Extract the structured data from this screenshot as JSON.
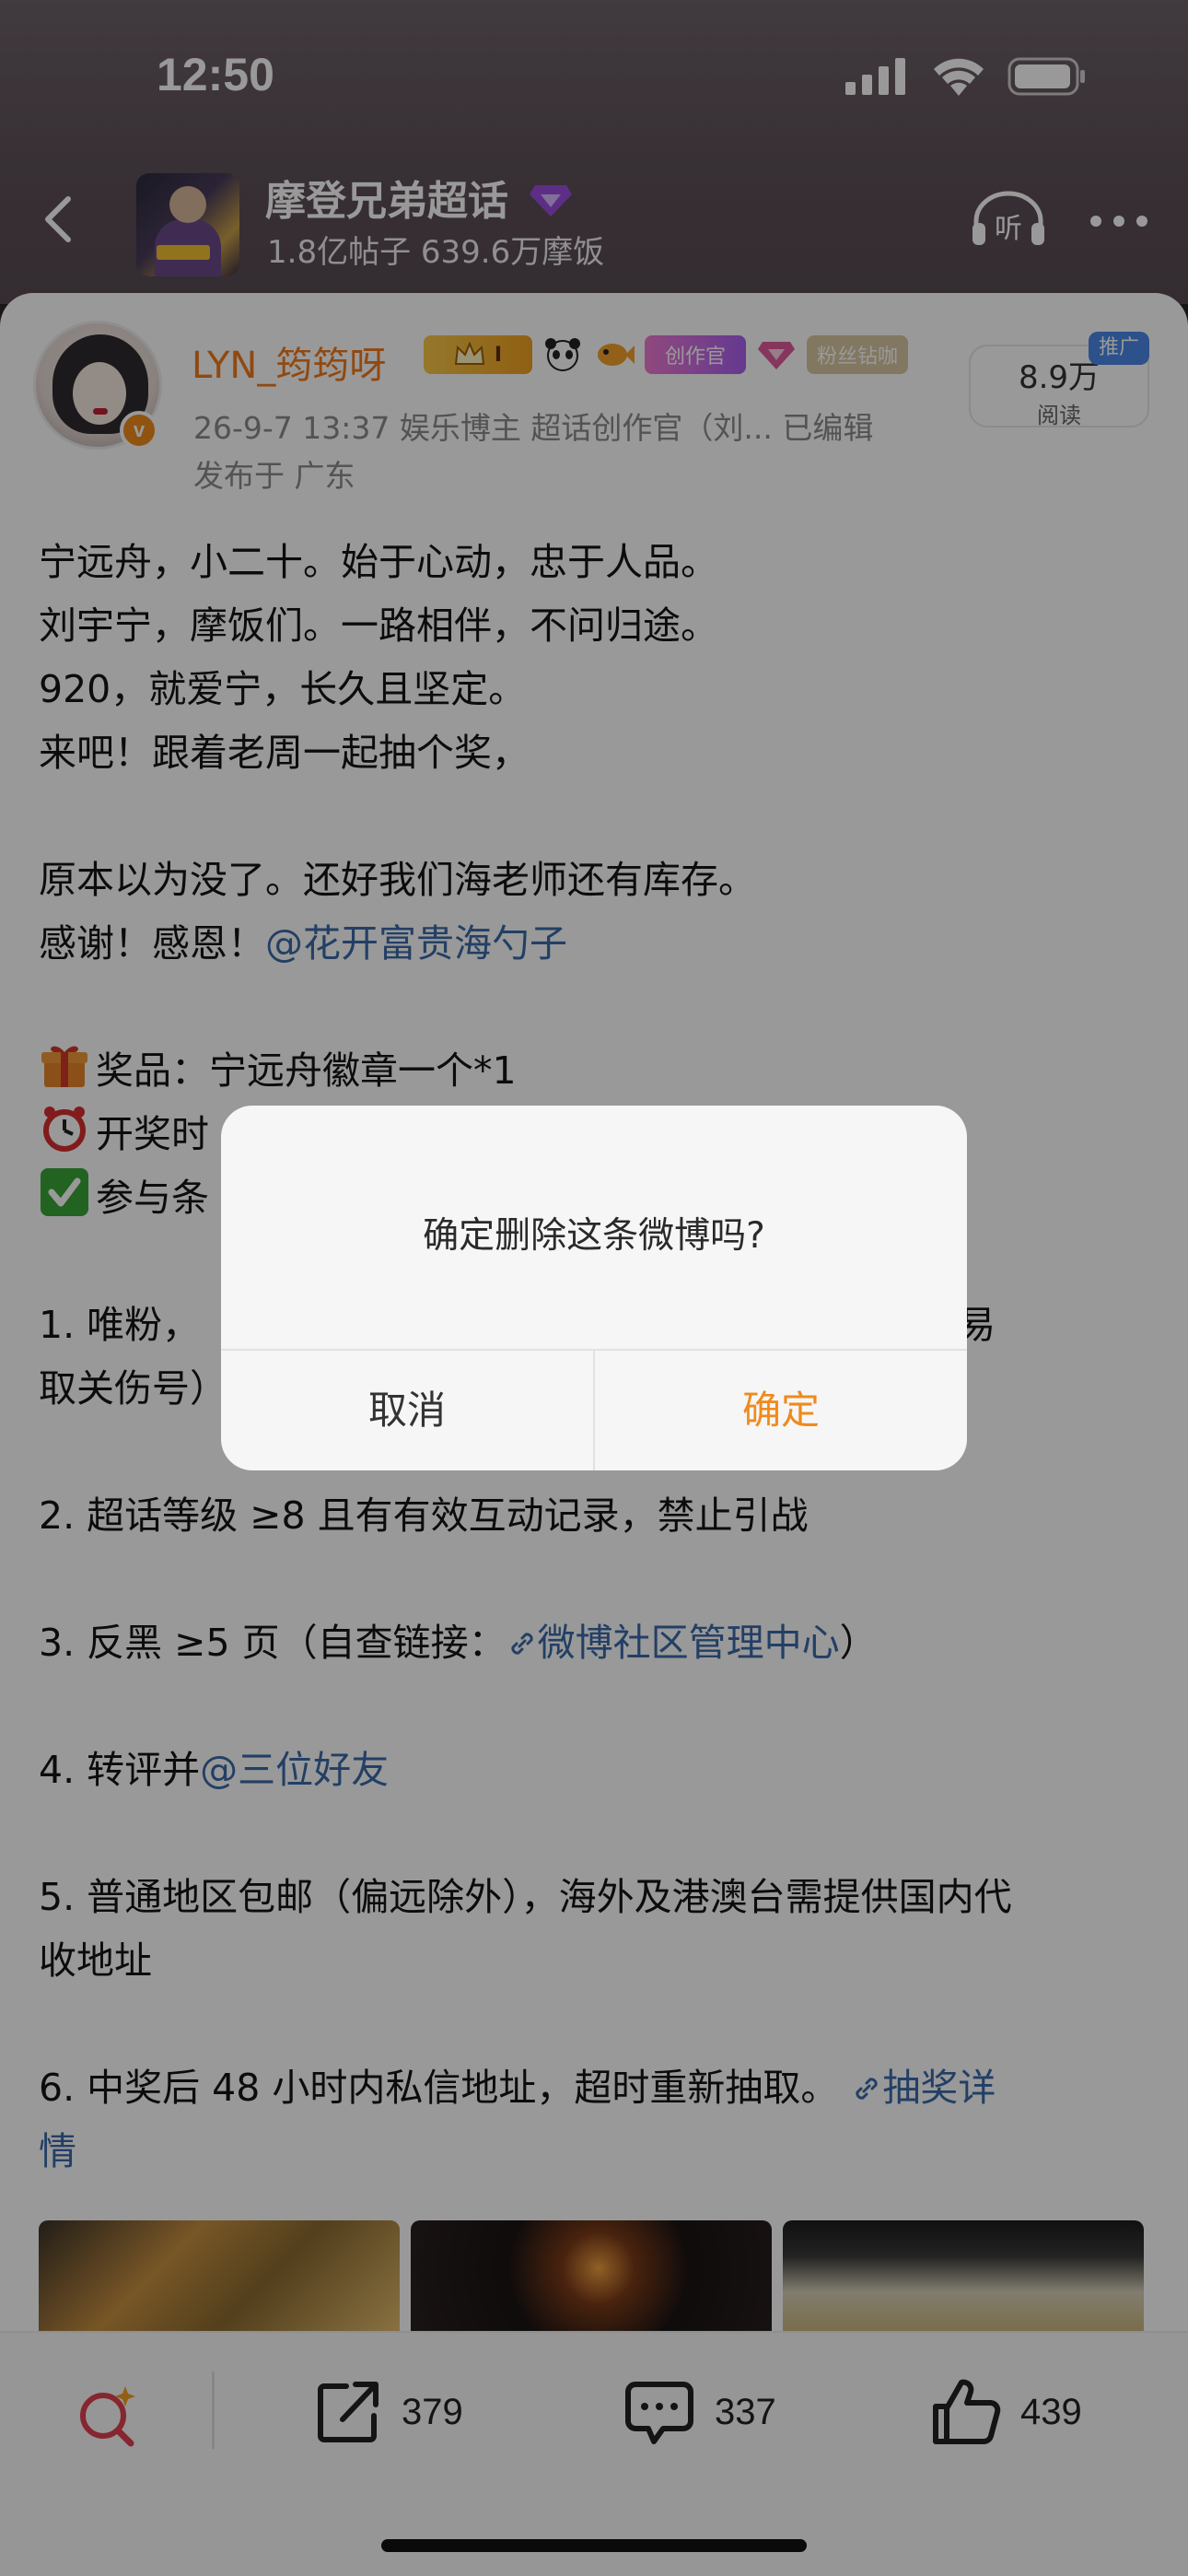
{
  "status_bar": {
    "time": "12:50"
  },
  "topic": {
    "title": "摩登兄弟超话",
    "stats": "1.8亿帖子 639.6万摩饭",
    "listen_label": "听"
  },
  "post": {
    "author": "LYN_筠筠呀",
    "verified_mark": "v",
    "badges": {
      "creator": "创作官",
      "fan_diamond": "粉丝钻咖",
      "level": "I"
    },
    "meta": "26-9-7 13:37 娱乐博主 超话创作官（刘... 已编辑",
    "location": "发布于 广东",
    "reads": {
      "value": "8.9万",
      "label": "阅读"
    },
    "promo_tag": "推广",
    "lines": {
      "l1": "宁远舟，小二十。始于心动，忠于人品。",
      "l2": "刘宇宁，摩饭们。一路相伴，不问归途。",
      "l3": "920，就爱宁，长久且坚定。",
      "l4": "来吧！跟着老周一起抽个奖，",
      "l5": "原本以为没了。还好我们海老师还有库存。",
      "l6_prefix": "感谢！感恩！",
      "l6_mention": "@花开富贵海勺子",
      "l7": "奖品：宁远舟徽章一个*1",
      "l8": "开奖时",
      "l9": "参与条",
      "l10_start": "1. 唯粉，",
      "l10_end": "请勿轻易",
      "l11": "取关伤号）",
      "l12": "2. 超话等级 ≥8 且有有效互动记录，禁止引战",
      "l13_prefix": "3. 反黑 ≥5 页（自查链接：",
      "l13_link": "微博社区管理中心",
      "l13_suffix": "）",
      "l14_prefix": "4. 转评并",
      "l14_mention": "@三位好友",
      "l15": "5. 普通地区包邮（偏远除外），海外及港澳台需提供国内代",
      "l16": "收地址",
      "l17_prefix": "6. 中奖后 48 小时内私信地址，超时重新抽取。",
      "l17_link": "抽奖详",
      "l18": "情"
    }
  },
  "actions": {
    "repost_count": "379",
    "comment_count": "337",
    "like_count": "439"
  },
  "dialog": {
    "message": "确定删除这条微博吗?",
    "cancel": "取消",
    "confirm": "确定"
  },
  "colors": {
    "accent_orange": "#f08a1c",
    "link_blue": "#3b6aa8",
    "dim": "rgba(0,0,0,0.40)"
  }
}
